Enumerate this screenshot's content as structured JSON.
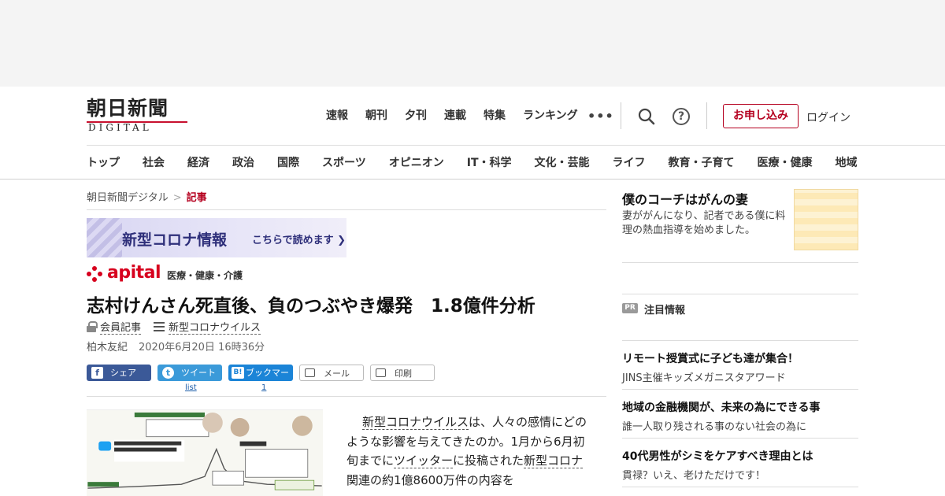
{
  "header": {
    "logo_jp": "朝日新聞",
    "logo_en": "DIGITAL",
    "top_nav": [
      "速報",
      "朝刊",
      "夕刊",
      "連載",
      "特集",
      "ランキング"
    ],
    "more": "•••",
    "help": "?",
    "apply_label": "お申し込み",
    "login_label": "ログイン",
    "accent_color": "#b5001f"
  },
  "category_nav": [
    "トップ",
    "社会",
    "経済",
    "政治",
    "国際",
    "スポーツ",
    "オピニオン",
    "IT・科学",
    "文化・芸能",
    "ライフ",
    "教育・子育て",
    "医療・健康",
    "地域"
  ],
  "breadcrumb": {
    "home": "朝日新聞デジタル",
    "sep": ">",
    "current": "記事"
  },
  "banner": {
    "title": "新型コロナ情報",
    "cta": "こちらで読めます ❯"
  },
  "apital": {
    "logo": "apital",
    "category": "医療・健康・介護"
  },
  "article": {
    "title": "志村けんさん死直後、負のつぶやき爆発　1.8億件分析",
    "member_label": "会員記事",
    "topic_label": "新型コロナウイルス",
    "author": "柏木友紀",
    "date": "2020年6月20日 16時36分",
    "body": {
      "p1_a": "新型コロナウイルス",
      "p1_b": "は、人々の感情にどのような影響を与えてきたのか。1月から6月初旬までに",
      "p1_c": "ツイッター",
      "p1_d": "に投稿された",
      "p1_e": "新型コロナ",
      "p1_f": "関連の約1億8600万件の内容を"
    }
  },
  "share": {
    "facebook": {
      "label": "シェア",
      "icon": "f"
    },
    "twitter": {
      "label": "ツイート",
      "icon": "t",
      "count": "list"
    },
    "hatena": {
      "label": "ブックマーク",
      "icon": "B!",
      "count": "1"
    },
    "mail": {
      "label": "メール"
    },
    "print": {
      "label": "印刷"
    }
  },
  "rail": {
    "promo": {
      "title": "僕のコーチはがんの妻",
      "desc": "妻ががんになり、記者である僕に料理の熱血指導を始めました。"
    },
    "pr_badge": "PR",
    "pr_title": "注目情報",
    "pr_items": [
      {
        "headline": "リモート授賞式に子ども達が集合！",
        "sub": "JINS主催キッズメガニスタアワード"
      },
      {
        "headline": "地域の金融機関が、未来の為にできる事",
        "sub": "誰一人取り残される事のない社会の為に"
      },
      {
        "headline": "40代男性がシミをケアすべき理由とは",
        "sub": "貫禄？いえ、老けただけです！"
      }
    ]
  }
}
